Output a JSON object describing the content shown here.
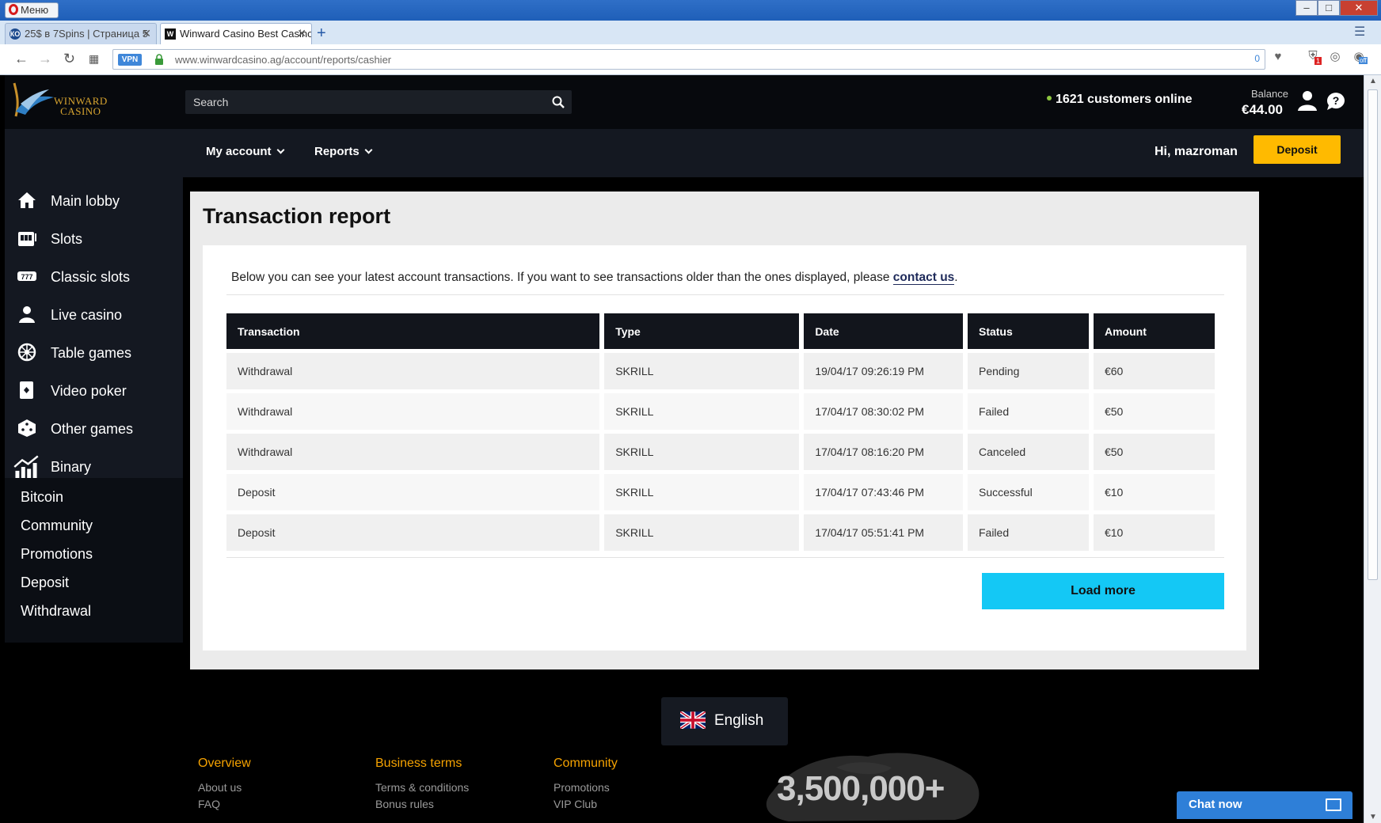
{
  "browser": {
    "menu_label": "Меню",
    "tabs": [
      {
        "title": "25$ в 7Spins | Страница 5",
        "favicon": "КО"
      },
      {
        "title": "Winward Casino Best Casino",
        "favicon": "W"
      }
    ],
    "vpn_label": "VPN",
    "url": "www.winwardcasino.ag/account/reports/cashier",
    "url_counter": "0",
    "ext_badge": "1",
    "ext_off": "off"
  },
  "header": {
    "logo_line1": "WINWARD",
    "logo_line2": "CASINO",
    "search_placeholder": "Search",
    "online_text": "1621 customers online",
    "balance_label": "Balance",
    "balance_value": "€44.00"
  },
  "subnav": {
    "my_account": "My account",
    "reports": "Reports",
    "greeting": "Hi, mazroman",
    "deposit": "Deposit"
  },
  "sidebar": {
    "items": [
      {
        "label": "Main lobby",
        "icon": "home-icon"
      },
      {
        "label": "Slots",
        "icon": "slot-machine-icon"
      },
      {
        "label": "Classic slots",
        "icon": "classic-slots-icon"
      },
      {
        "label": "Live casino",
        "icon": "dealer-icon"
      },
      {
        "label": "Table games",
        "icon": "roulette-icon"
      },
      {
        "label": "Video poker",
        "icon": "card-icon"
      },
      {
        "label": "Other games",
        "icon": "dice-icon"
      },
      {
        "label": "Binary",
        "icon": "chart-icon"
      }
    ],
    "links": [
      "Bitcoin",
      "Community",
      "Promotions",
      "Deposit",
      "Withdrawal"
    ]
  },
  "report": {
    "title": "Transaction report",
    "intro_before": "Below you can see your latest account transactions. If you want to see transactions older than the ones displayed, please ",
    "intro_link": "contact us",
    "intro_after": ".",
    "columns": [
      "Transaction",
      "Type",
      "Date",
      "Status",
      "Amount"
    ],
    "rows": [
      [
        "Withdrawal",
        "SKRILL",
        "19/04/17 09:26:19 PM",
        "Pending",
        "€60"
      ],
      [
        "Withdrawal",
        "SKRILL",
        "17/04/17 08:30:02 PM",
        "Failed",
        "€50"
      ],
      [
        "Withdrawal",
        "SKRILL",
        "17/04/17 08:16:20 PM",
        "Canceled",
        "€50"
      ],
      [
        "Deposit",
        "SKRILL",
        "17/04/17 07:43:46 PM",
        "Successful",
        "€10"
      ],
      [
        "Deposit",
        "SKRILL",
        "17/04/17 05:51:41 PM",
        "Failed",
        "€10"
      ]
    ],
    "load_more": "Load more"
  },
  "footer": {
    "language": "English",
    "players": "3,500,000+",
    "columns": [
      {
        "heading": "Overview",
        "links": [
          "About us",
          "FAQ"
        ]
      },
      {
        "heading": "Business terms",
        "links": [
          "Terms & conditions",
          "Bonus rules"
        ]
      },
      {
        "heading": "Community",
        "links": [
          "Promotions",
          "VIP Club"
        ]
      }
    ],
    "chat": "Chat now"
  },
  "colors": {
    "accent_yellow": "#ffba00",
    "load_more_cyan": "#14c8f5",
    "footer_orange": "#f5a200",
    "chat_blue": "#2e7fd8"
  }
}
